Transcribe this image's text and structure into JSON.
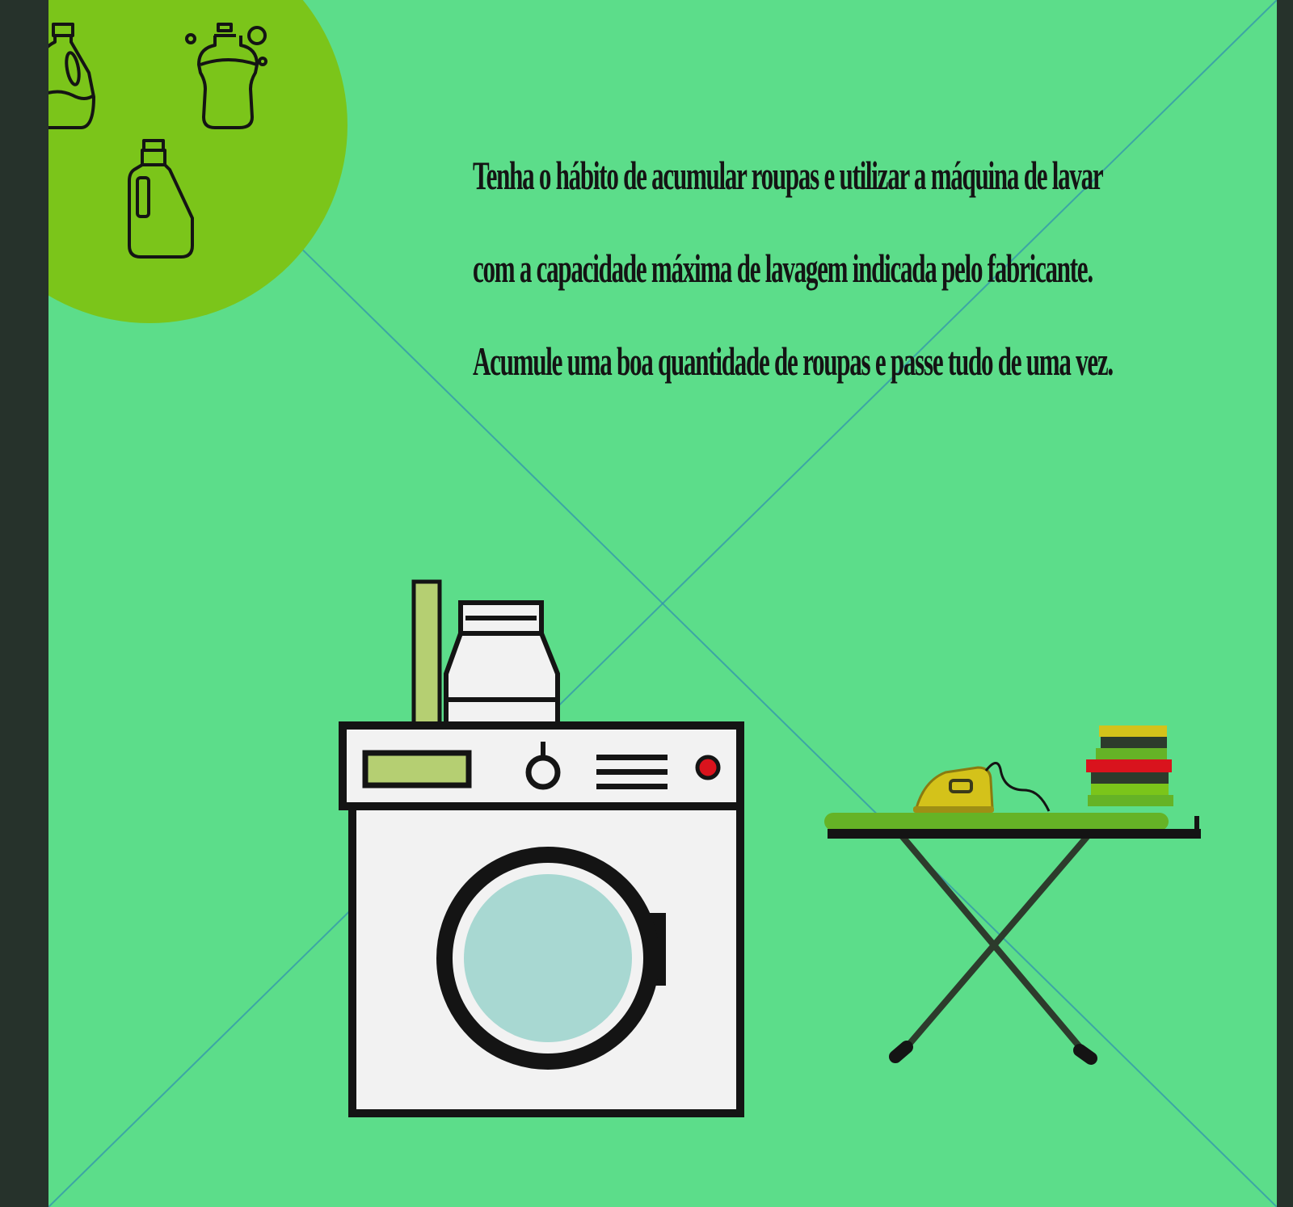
{
  "poster": {
    "lines": [
      "Tenha o hábito de acumular roupas e utilizar a máquina de lavar",
      "com a capacidade máxima de lavagem indicada pelo fabricante.",
      "Acumule uma boa quantidade de roupas e passe tudo de uma vez."
    ]
  },
  "colors": {
    "background": "#5cdd8a",
    "corner_circle": "#7bc51a",
    "outline": "#141414",
    "washer_body": "#f2f2f2",
    "washer_window": "#a8d8d2",
    "display": "#b5cf72",
    "indicator": "#d9131d",
    "board": "#65b326",
    "iron": "#d4c21a"
  },
  "icons": [
    "detergent-bottle-icon",
    "soap-bottle-icon",
    "softener-bottle-icon",
    "washing-machine-icon",
    "ironing-board-icon",
    "iron-icon",
    "folded-clothes-icon"
  ]
}
